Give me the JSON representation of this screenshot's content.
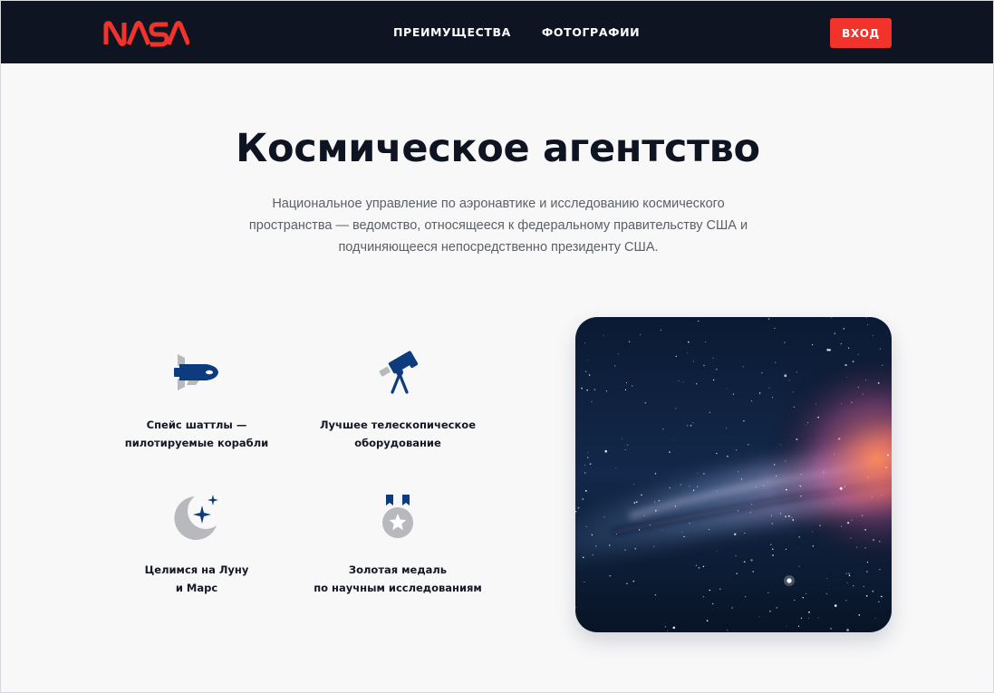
{
  "header": {
    "logo": "NASA",
    "nav": [
      {
        "label": "ПРЕИМУЩЕСТВА"
      },
      {
        "label": "ФОТОГРАФИИ"
      }
    ],
    "login_label": "ВХОД"
  },
  "hero": {
    "title": "Космическое агентство",
    "subtitle": "Национальное управление по аэронавтике и исследованию космического пространства — ведомство, относящееся к федеральному правительству США и подчиняющееся непосредственно президенту США."
  },
  "features": [
    {
      "icon": "space-shuttle-icon",
      "line1": "Спейс шаттлы —",
      "line2": "пилотируемые корабли"
    },
    {
      "icon": "telescope-icon",
      "line1": "Лучшее телескопическое",
      "line2": "оборудование"
    },
    {
      "icon": "moon-stars-icon",
      "line1": "Целимся на Луну",
      "line2": "и Марс"
    },
    {
      "icon": "medal-icon",
      "line1": "Золотая медаль",
      "line2": "по научным исследованиям"
    }
  ],
  "colors": {
    "header_bg": "#0e1421",
    "accent": "#f2332c",
    "icon_blue": "#0d3c7e",
    "icon_gray": "#b7b9bd"
  }
}
